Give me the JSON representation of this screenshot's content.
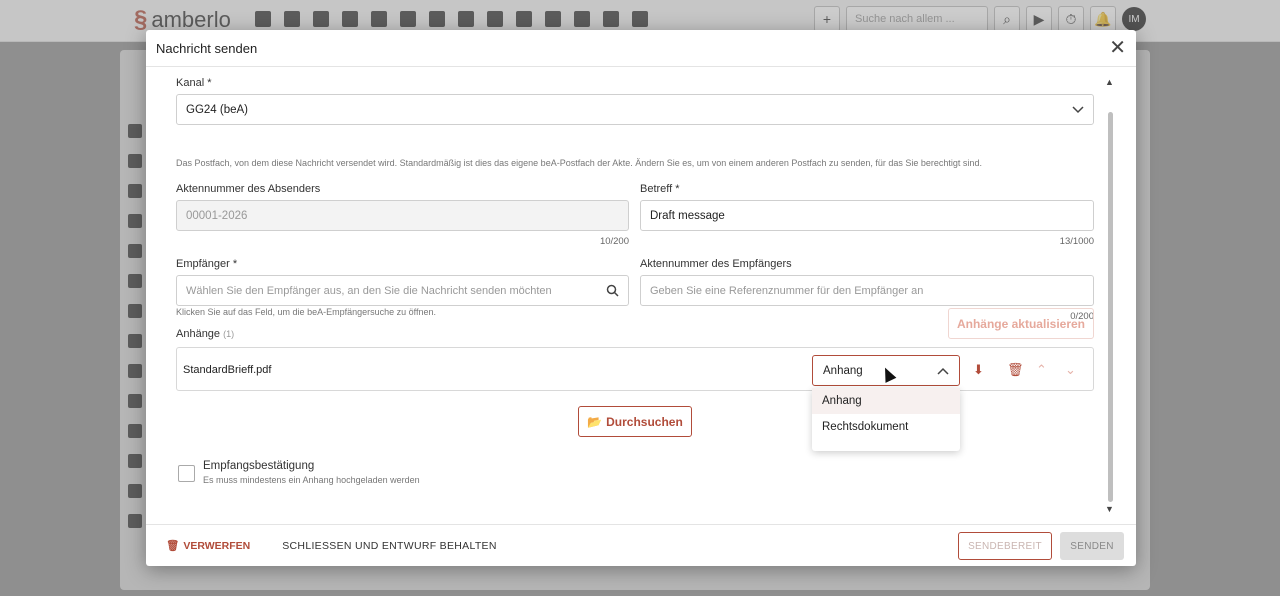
{
  "app": {
    "logo_text": "amberlo",
    "search_placeholder": "Suche nach allem ...",
    "user_initials": "IM"
  },
  "modal": {
    "title": "Nachricht senden",
    "channel": {
      "label": "Kanal *",
      "value": "GG24 (beA)",
      "hint": "Das Postfach, von dem diese Nachricht versendet wird. Standardmäßig ist dies das eigene beA-Postfach der Akte. Ändern Sie es, um von einem anderen Postfach zu senden, für das Sie berechtigt sind."
    },
    "sender_ref": {
      "label": "Aktennummer des Absenders",
      "value": "00001-2026",
      "counter": "10/200"
    },
    "subject": {
      "label": "Betreff *",
      "value": "Draft message",
      "counter": "13/1000"
    },
    "recipient": {
      "label": "Empfänger *",
      "placeholder": "Wählen Sie den Empfänger aus, an den Sie die Nachricht senden möchten",
      "hint": "Klicken Sie auf das Feld, um die beA-Empfängersuche zu öffnen."
    },
    "recipient_ref": {
      "label": "Aktennummer des Empfängers",
      "placeholder": "Geben Sie eine Referenznummer für den Empfänger an",
      "counter": "0/200"
    },
    "attachments": {
      "label": "Anhänge",
      "count": "(1)",
      "refresh_label": "Anhänge aktualisieren",
      "file_name": "StandardBrieff.pdf",
      "type_value": "Anhang",
      "type_options": [
        "Anhang",
        "Rechtsdokument"
      ],
      "browse_label": "Durchsuchen"
    },
    "receipt": {
      "label": "Empfangsbestätigung",
      "hint": "Es muss mindestens ein Anhang hochgeladen werden"
    },
    "footer": {
      "discard_label": "VERWERFEN",
      "close_label": "SCHLIESSEN UND ENTWURF BEHALTEN",
      "ready_label": "SENDEBEREIT",
      "send_label": "SENDEN"
    }
  },
  "colors": {
    "accent": "#b14c3a"
  }
}
